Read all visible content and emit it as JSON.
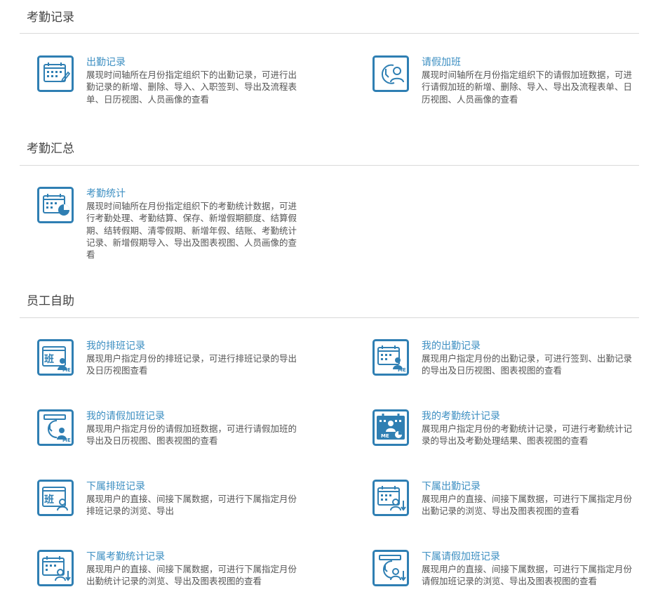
{
  "colors": {
    "accent": "#3d8fc2",
    "icon": "#2f7fb3",
    "divider": "#d9d9d9",
    "text": "#555555"
  },
  "sections": [
    {
      "title": "考勤记录"
    },
    {
      "title": "考勤汇总"
    },
    {
      "title": "员工自助"
    }
  ],
  "modules": {
    "attendance_record": {
      "icon": "calendar-edit-icon",
      "title": "出勤记录",
      "desc": "展现时间轴所在月份指定组织下的出勤记录，可进行出勤记录的新增、删除、导入、入职签到、导出及流程表单、日历视图、人员画像的查看"
    },
    "leave_overtime": {
      "icon": "clock-person-icon",
      "title": "请假加班",
      "desc": "展现时间轴所在月份指定组织下的请假加班数据，可进行请假加班的新增、删除、导入、导出及流程表单、日历视图、人员画像的查看"
    },
    "attendance_stats": {
      "icon": "calendar-chart-icon",
      "title": "考勤统计",
      "desc": "展现时间轴所在月份指定组织下的考勤统计数据，可进行考勤处理、考勤结算、保存、新增假期额度、结算假期、结转假期、清零假期、新增年假、结账、考勤统计记录、新增假期导入、导出及图表视图、人员画像的查看"
    },
    "my_shift": {
      "icon": "shift-me-icon",
      "title": "我的排班记录",
      "desc": "展现用户指定月份的排班记录，可进行排班记录的导出及日历视图查看"
    },
    "my_attendance": {
      "icon": "calendar-me-icon",
      "title": "我的出勤记录",
      "desc": "展现用户指定月份的出勤记录，可进行签到、出勤记录的导出及日历视图、图表视图的查看"
    },
    "my_leave": {
      "icon": "clock-me-icon",
      "title": "我的请假加班记录",
      "desc": "展现用户指定月份的请假加班数据，可进行请假加班的导出及日历视图、图表视图的查看"
    },
    "my_stats": {
      "icon": "stats-me-icon",
      "title": "我的考勤统计记录",
      "desc": "展现用户指定月份的考勤统计记录，可进行考勤统计记录的导出及考勤处理结果、图表视图的查看"
    },
    "sub_shift": {
      "icon": "shift-subordinate-icon",
      "title": "下属排班记录",
      "desc": "展现用户的直接、间接下属数据，可进行下属指定月份排班记录的浏览、导出"
    },
    "sub_attendance": {
      "icon": "calendar-subordinate-icon",
      "title": "下属出勤记录",
      "desc": "展现用户的直接、间接下属数据，可进行下属指定月份出勤记录的浏览、导出及图表视图的查看"
    },
    "sub_stats": {
      "icon": "stats-subordinate-icon",
      "title": "下属考勤统计记录",
      "desc": "展现用户的直接、间接下属数据，可进行下属指定月份出勤统计记录的浏览、导出及图表视图的查看"
    },
    "sub_leave": {
      "icon": "clock-subordinate-icon",
      "title": "下属请假加班记录",
      "desc": "展现用户的直接、间接下属数据，可进行下属指定月份请假加班记录的浏览、导出及图表视图的查看"
    }
  },
  "labels": {
    "shift_char": "班",
    "me": "ME"
  }
}
